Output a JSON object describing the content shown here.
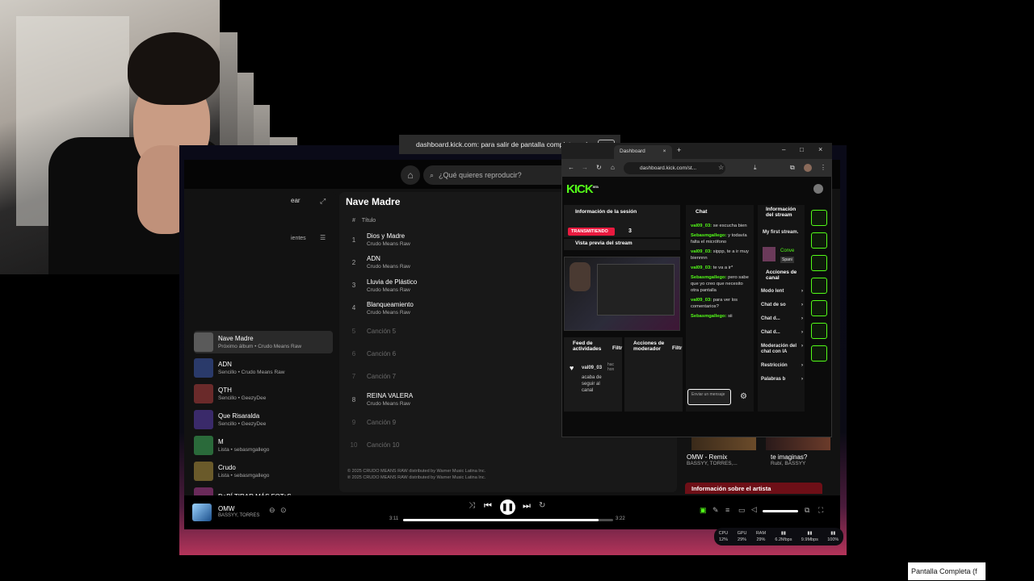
{
  "notice": {
    "text": "dashboard.kick.com: para salir de pantalla completa, pulsa",
    "key": "Esc"
  },
  "spotify": {
    "search_placeholder": "¿Qué quieres reproducir?",
    "library_label": "ear",
    "recent_label": "ientes",
    "playlist_title": "Nave Madre",
    "col_title": "Título",
    "tracks": [
      {
        "n": "1",
        "title": "Dios y Madre",
        "artist": "Crudo Means Raw",
        "dim": false
      },
      {
        "n": "2",
        "title": "ADN",
        "artist": "Crudo Means Raw",
        "dim": false
      },
      {
        "n": "3",
        "title": "Lluvia de Plástico",
        "artist": "Crudo Means Raw",
        "dim": false
      },
      {
        "n": "4",
        "title": "Blanqueamiento",
        "artist": "Crudo Means Raw",
        "dim": false
      },
      {
        "n": "5",
        "title": "Canción 5",
        "artist": "",
        "dim": true
      },
      {
        "n": "6",
        "title": "Canción 6",
        "artist": "",
        "dim": true
      },
      {
        "n": "7",
        "title": "Canción 7",
        "artist": "",
        "dim": true
      },
      {
        "n": "8",
        "title": "REINA VALERA",
        "artist": "Crudo Means Raw",
        "dim": false
      },
      {
        "n": "9",
        "title": "Canción 9",
        "artist": "",
        "dim": true
      },
      {
        "n": "10",
        "title": "Canción 10",
        "artist": "",
        "dim": true
      }
    ],
    "copyright1": "© 2025 CRUDO MEANS RAW distributed by Warner Music Latina Inc.",
    "copyright2": "℗ 2025 CRUDO MEANS RAW distributed by Warner Music Latina Inc.",
    "library": [
      {
        "title": "Nave Madre",
        "sub": "Próximo álbum • Crudo Means Raw",
        "active": true
      },
      {
        "title": "ADN",
        "sub": "Sencillo • Crudo Means Raw",
        "active": false
      },
      {
        "title": "QTH",
        "sub": "Sencillo • GeezyDee",
        "active": false
      },
      {
        "title": "Que Risaralda",
        "sub": "Sencillo • GeezyDee",
        "active": false
      },
      {
        "title": "M",
        "sub": "Lista • sebasmgallego",
        "active": false
      },
      {
        "title": "Crudo",
        "sub": "Lista • sebasmgallego",
        "active": false
      },
      {
        "title": "DeBÍ TIRAR MÁS FOToS",
        "sub": "",
        "active": false
      }
    ],
    "cards": [
      {
        "title": "OMW - Remix",
        "sub": "BASSYY, TORRES,..."
      },
      {
        "title": "te imaginas?",
        "sub": "Rubí, BASSYY"
      }
    ],
    "artist_info": "Información sobre el artista",
    "now_playing": {
      "title": "OMW",
      "artist": "BASSYY, TORRES",
      "elapsed": "3:11",
      "total": "3:22",
      "progress": 0.93
    }
  },
  "stats": [
    {
      "label": "CPU",
      "value": "12%"
    },
    {
      "label": "GPU",
      "value": "29%"
    },
    {
      "label": "RAM",
      "value": "29%"
    },
    {
      "label": "",
      "value": "6.2Mbps"
    },
    {
      "label": "",
      "value": "9.9Mbps"
    },
    {
      "label": "",
      "value": "100%"
    }
  ],
  "browser": {
    "tab_label": "Dashboard",
    "url": "dashboard.kick.com/st...",
    "logo": "KICK",
    "logo_badge": "BETA"
  },
  "kick": {
    "session_title": "Información de la sesión",
    "live_badge": "TRANSMITIENDO",
    "viewers": "3",
    "preview_title": "Vista previa del stream",
    "feed_title": "Feed de actividades",
    "feed_filter": "Filtr",
    "mod_actions": "Acciones de moderador",
    "mod_filter": "Filtr",
    "feed_user": "val09_03",
    "feed_time": "hac hon",
    "feed_text": "acaba de seguir al canal",
    "chat_title": "Chat",
    "messages": [
      {
        "user": "val09_03:",
        "text": "se escucha bien"
      },
      {
        "user": "Sebasmgallego:",
        "text": "y todavía falta el micrófono"
      },
      {
        "user": "val09_03:",
        "text": "sippp, te a ir muy biennnn"
      },
      {
        "user": "val09_03:",
        "text": "te va a ir*"
      },
      {
        "user": "Sebasmgallego:",
        "text": "pero sabe que yo creo que necesito otra pantalla"
      },
      {
        "user": "val09_03:",
        "text": "para ver los comentarios?"
      },
      {
        "user": "Sebasmgallego:",
        "text": "sii"
      }
    ],
    "chat_placeholder": "Enviar un mensaje",
    "stream_info_title": "Información del stream",
    "stream_name": "My first stream.",
    "category": "Conve",
    "language": "Spani",
    "channel_actions": "Acciones de canal",
    "actions": [
      "Modo lent",
      "Chat de so",
      "Chat d...",
      "Chat d...",
      "Moderación del chat con IA",
      "Restricción",
      "Palabras b"
    ]
  },
  "fullscreen_button": "Pantalla Completa (f"
}
